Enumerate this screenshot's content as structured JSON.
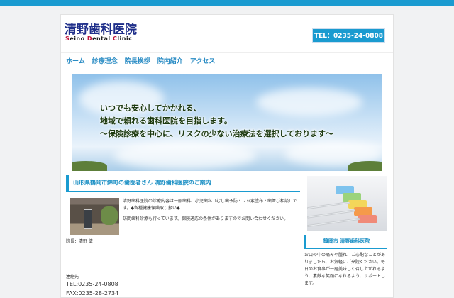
{
  "header": {
    "logo_jp": "清野歯科医院",
    "logo_en": [
      {
        "cap": "S",
        "rest": "eino "
      },
      {
        "cap": "D",
        "rest": "ental "
      },
      {
        "cap": "C",
        "rest": "linic"
      }
    ],
    "tel": "TEL：0235-24-0808"
  },
  "nav": [
    "ホーム",
    "診療理念",
    "院長挨拶",
    "院内紹介",
    "アクセス"
  ],
  "hero": {
    "lines": [
      "いつでも安心してかかれる、",
      "地域で頼れる歯科医院を目指します。",
      "～保険診療を中心に、リスクの少ない治療法を選択しております～"
    ]
  },
  "main": {
    "heading": "山形県鶴岡市錦町の歯医者さん 清野歯科医院のご案内",
    "paragraphs": [
      "清野歯科医院の診療内容は一般歯科、小児歯科（むし歯予防・フッ素塗布・歯並び相談）です。◆各種健康保険取り扱い◆",
      "訪問歯科診療も行っています。保険適応の条件がありますのでお問い合わせください。"
    ],
    "director": "院長：清野 肇",
    "contact_label": "連絡先",
    "tel": "TEL:0235-24-0808",
    "fax": "FAX:0235-28-2734"
  },
  "sidebar": {
    "heading": "鶴岡市 清野歯科医院",
    "text": "お口の中の痛みや腫れ、ご心配なことがありましたら、お気軽にご来院ください。毎日のお食事が一層美味しく召し上がれるよう、素敵な笑顔になれるよう、サポートします。"
  },
  "colors": {
    "accent": "#1a9bd0",
    "logo": "#1f2f8a",
    "logo_caps": "#c0143c"
  }
}
